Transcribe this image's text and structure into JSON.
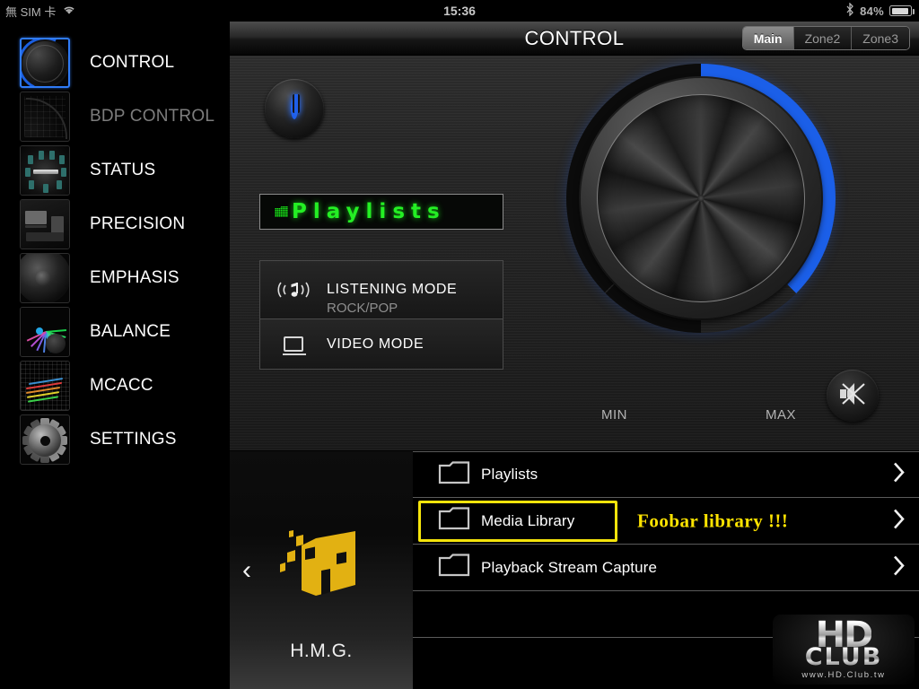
{
  "statusbar": {
    "carrier": "無 SIM 卡",
    "wifi_icon": "wifi-icon",
    "time": "15:36",
    "bluetooth_icon": "bluetooth-icon",
    "battery_percent": "84%"
  },
  "sidebar": {
    "items": [
      {
        "label": "CONTROL",
        "icon": "volume-knob-icon",
        "selected": true,
        "disabled": false
      },
      {
        "label": "BDP CONTROL",
        "icon": "dpad-grid-icon",
        "selected": false,
        "disabled": true
      },
      {
        "label": "STATUS",
        "icon": "speaker-layout-icon",
        "selected": false,
        "disabled": false
      },
      {
        "label": "PRECISION",
        "icon": "av-room-icon",
        "selected": false,
        "disabled": false
      },
      {
        "label": "EMPHASIS",
        "icon": "woofer-icon",
        "selected": false,
        "disabled": false
      },
      {
        "label": "BALANCE",
        "icon": "spectrum-fan-icon",
        "selected": false,
        "disabled": false
      },
      {
        "label": "MCACC",
        "icon": "eq-mesh-icon",
        "selected": false,
        "disabled": false
      },
      {
        "label": "SETTINGS",
        "icon": "gear-icon",
        "selected": false,
        "disabled": false
      }
    ]
  },
  "header": {
    "title": "CONTROL",
    "zones": [
      {
        "label": "Main",
        "selected": true
      },
      {
        "label": "Zone2",
        "selected": false
      },
      {
        "label": "Zone3",
        "selected": false
      }
    ]
  },
  "main": {
    "power_button": "power-icon",
    "display": {
      "icon": "folder-icon",
      "text": "Playlists"
    },
    "listening_mode": {
      "label": "LISTENING MODE",
      "sub": "ROCK/POP",
      "icon": "listening-mode-icon"
    },
    "video_mode": {
      "label": "VIDEO MODE",
      "icon": "monitor-icon"
    },
    "volume": {
      "min_label": "MIN",
      "max_label": "MAX",
      "mute_icon": "mute-icon"
    }
  },
  "bottom": {
    "source": {
      "back_icon": "chevron-left-icon",
      "name": "H.M.G."
    },
    "list": [
      {
        "label": "Playlists",
        "highlighted": false,
        "annotation": ""
      },
      {
        "label": "Media Library",
        "highlighted": true,
        "annotation": "Foobar library !!!"
      },
      {
        "label": "Playback Stream Capture",
        "highlighted": false,
        "annotation": ""
      }
    ]
  },
  "watermark": {
    "line1": "HD",
    "line2": "CLUB",
    "url": "www.HD.Club.tw"
  },
  "colors": {
    "accent_blue": "#1b5fe8",
    "lcd_green": "#24ef24",
    "highlight_yellow": "#f5e40b"
  }
}
